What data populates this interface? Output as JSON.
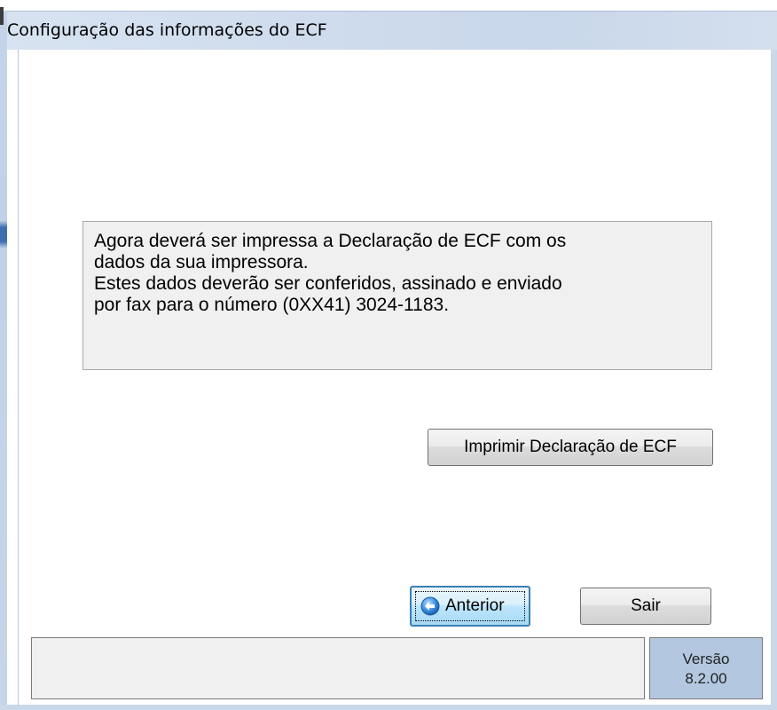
{
  "window": {
    "title": "Configuração das informações do ECF"
  },
  "message": {
    "lines": [
      "Agora deverá ser impressa a Declaração de ECF com os",
      "dados da sua impressora.",
      "Estes dados deverão ser conferidos, assinado e enviado",
      "por fax para o número (0XX41)  3024-1183."
    ]
  },
  "buttons": {
    "print_label": "Imprimir Declaração de ECF",
    "previous_label": "Anterior",
    "exit_label": "Sair"
  },
  "icons": {
    "previous": "back-arrow-icon"
  },
  "status": {
    "left_text": "",
    "version_label": "Versão",
    "version_value": "8.2.00"
  },
  "colors": {
    "titlebar": "#cfdced",
    "version_panel": "#b3c8e0",
    "focus_button_border": "#3c7fb1"
  }
}
